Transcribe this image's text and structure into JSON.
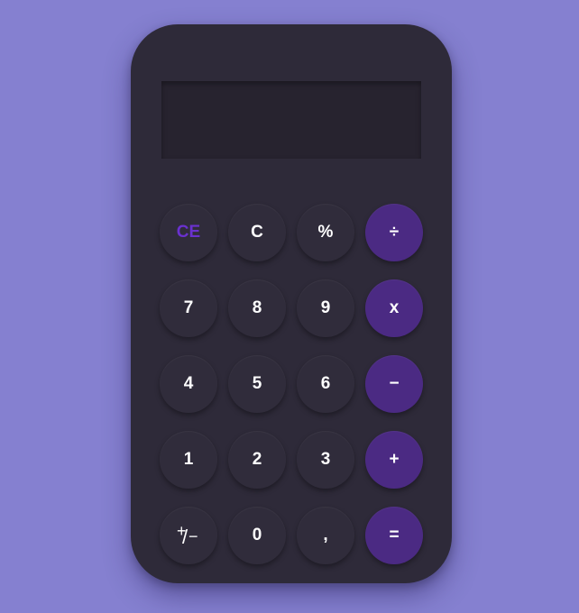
{
  "display": {
    "value": ""
  },
  "keys": {
    "clear_entry": "CE",
    "clear": "C",
    "percent": "%",
    "divide": "÷",
    "seven": "7",
    "eight": "8",
    "nine": "9",
    "multiply": "x",
    "four": "4",
    "five": "5",
    "six": "6",
    "subtract": "−",
    "one": "1",
    "two": "2",
    "three": "3",
    "add": "+",
    "negate": {
      "plus": "+",
      "slash": "/",
      "minus": "−"
    },
    "zero": "0",
    "decimal": ",",
    "equals": "="
  },
  "colors": {
    "background": "#8580d0",
    "body": "#2e2a39",
    "key": "#302c3b",
    "operator_key": "#4b2a83",
    "clear_entry_text": "#6a31cf"
  }
}
